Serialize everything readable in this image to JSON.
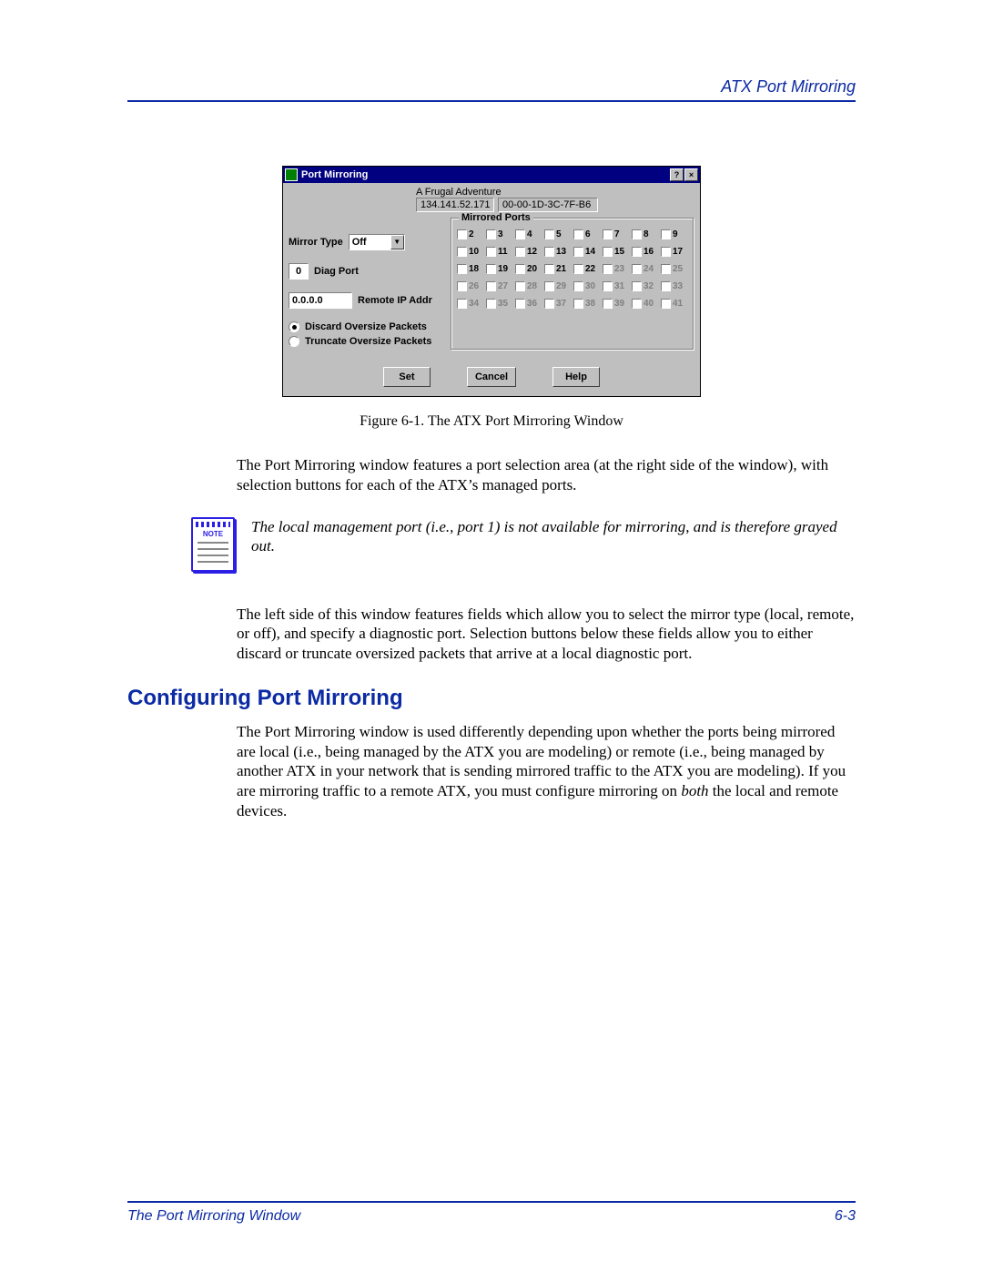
{
  "header": {
    "right": "ATX Port Mirroring"
  },
  "window": {
    "title": "Port Mirroring",
    "help_btn": "?",
    "close_btn": "×",
    "hostname": "A Frugal Adventure",
    "ip": "134.141.52.171",
    "mac": "00-00-1D-3C-7F-B6",
    "mirror_type_label": "Mirror Type",
    "mirror_type_value": "Off",
    "diag_port_label": "Diag Port",
    "diag_port_value": "0",
    "remote_ip_label": "Remote IP Addr",
    "remote_ip_value": "0.0.0.0",
    "radio_discard": "Discard Oversize Packets",
    "radio_truncate": "Truncate Oversize Packets",
    "group_mirrored_ports": "Mirrored Ports",
    "ports": {
      "row1": [
        {
          "n": "2",
          "d": false
        },
        {
          "n": "3",
          "d": false
        },
        {
          "n": "4",
          "d": false
        },
        {
          "n": "5",
          "d": false
        },
        {
          "n": "6",
          "d": false
        },
        {
          "n": "7",
          "d": false
        },
        {
          "n": "8",
          "d": false
        },
        {
          "n": "9",
          "d": false
        }
      ],
      "row2": [
        {
          "n": "10",
          "d": false
        },
        {
          "n": "11",
          "d": false
        },
        {
          "n": "12",
          "d": false
        },
        {
          "n": "13",
          "d": false
        },
        {
          "n": "14",
          "d": false
        },
        {
          "n": "15",
          "d": false
        },
        {
          "n": "16",
          "d": false
        },
        {
          "n": "17",
          "d": false
        }
      ],
      "row3": [
        {
          "n": "18",
          "d": false
        },
        {
          "n": "19",
          "d": false
        },
        {
          "n": "20",
          "d": false
        },
        {
          "n": "21",
          "d": false
        },
        {
          "n": "22",
          "d": false
        },
        {
          "n": "23",
          "d": true
        },
        {
          "n": "24",
          "d": true
        },
        {
          "n": "25",
          "d": true
        }
      ],
      "row4": [
        {
          "n": "26",
          "d": true
        },
        {
          "n": "27",
          "d": true
        },
        {
          "n": "28",
          "d": true
        },
        {
          "n": "29",
          "d": true
        },
        {
          "n": "30",
          "d": true
        },
        {
          "n": "31",
          "d": true
        },
        {
          "n": "32",
          "d": true
        },
        {
          "n": "33",
          "d": true
        }
      ],
      "row5": [
        {
          "n": "34",
          "d": true
        },
        {
          "n": "35",
          "d": true
        },
        {
          "n": "36",
          "d": true
        },
        {
          "n": "37",
          "d": true
        },
        {
          "n": "38",
          "d": true
        },
        {
          "n": "39",
          "d": true
        },
        {
          "n": "40",
          "d": true
        },
        {
          "n": "41",
          "d": true
        }
      ]
    },
    "btn_set": "Set",
    "btn_cancel": "Cancel",
    "btn_help": "Help"
  },
  "figure_caption": "Figure 6-1. The ATX Port Mirroring Window",
  "para1": "The Port Mirroring window features a port selection area (at the right side of the window), with selection buttons for each of the ATX’s managed ports.",
  "note_label": "NOTE",
  "note_text": "The local management port (i.e., port 1) is not available for mirroring, and is therefore grayed out.",
  "para2": "The left side of this window features fields which allow you to select the mirror type (local, remote, or off), and specify a diagnostic port. Selection buttons below these fields allow you to either discard or truncate oversized packets that arrive at a local diagnostic port.",
  "h2": "Configuring Port Mirroring",
  "para3a": "The Port Mirroring window is used differently depending upon whether the ports being mirrored are local (i.e., being managed by the ATX you are modeling) or remote (i.e., being managed by another ATX in your network that is sending mirrored traffic to the ATX you are modeling). If you are mirroring traffic to a remote ATX, you must configure mirroring on ",
  "para3_em": "both",
  "para3b": " the local and remote devices.",
  "footer": {
    "left": "The Port Mirroring Window",
    "right": "6-3"
  }
}
